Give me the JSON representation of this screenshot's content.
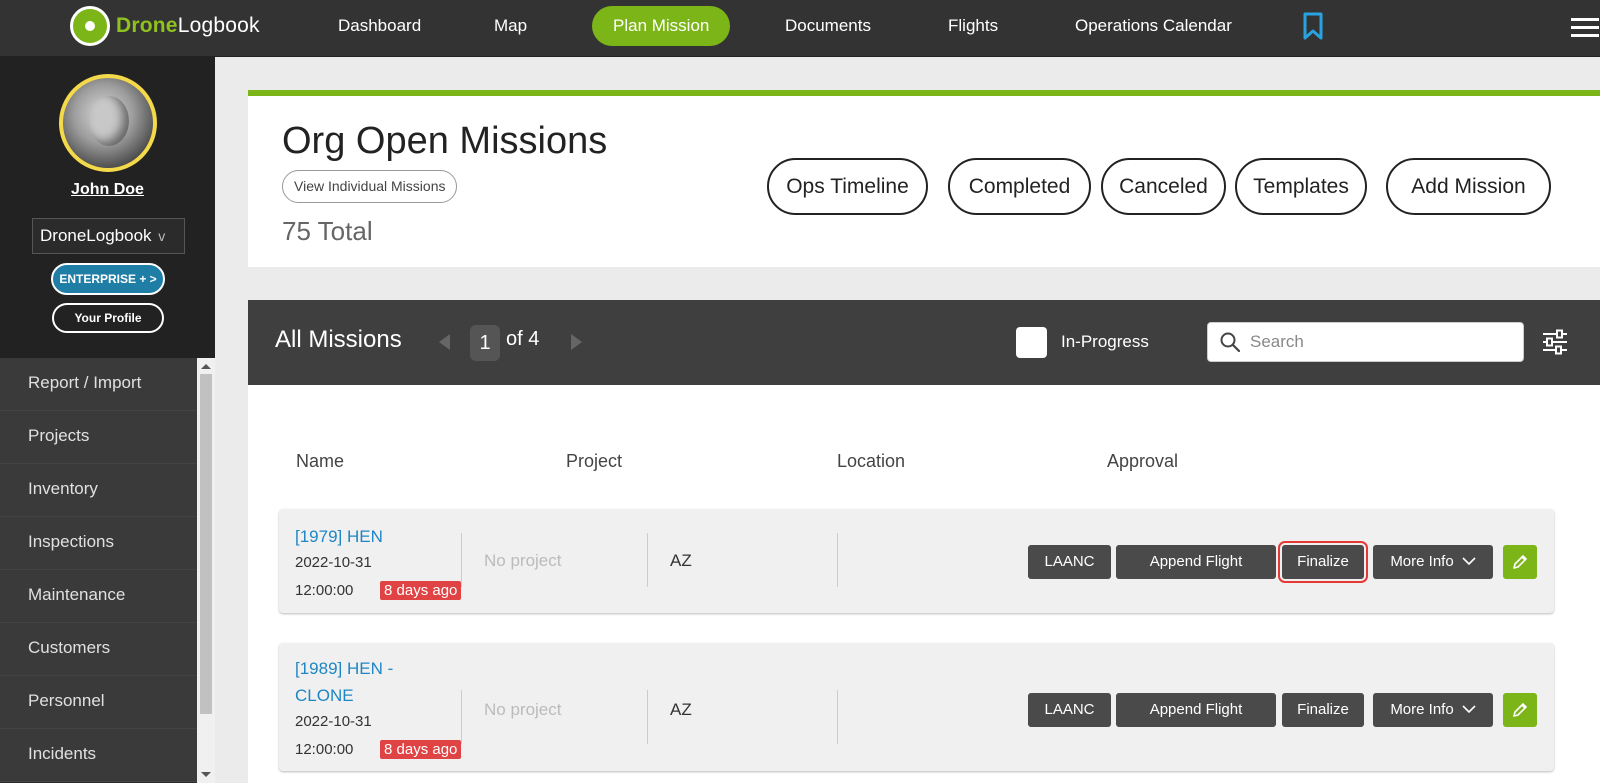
{
  "brand": {
    "part1": "Drone",
    "part2": "Logbook"
  },
  "nav": {
    "items": [
      "Dashboard",
      "Map",
      "Plan Mission",
      "Documents",
      "Flights",
      "Operations Calendar"
    ],
    "active": "Plan Mission"
  },
  "sidebar": {
    "user_name": "John Doe",
    "org": "DroneLogbook",
    "org_chevron": "v",
    "plan_badge": "ENTERPRISE + >",
    "profile_button": "Your Profile",
    "menu": [
      "Report / Import",
      "Projects",
      "Inventory",
      "Inspections",
      "Maintenance",
      "Customers",
      "Personnel",
      "Incidents"
    ]
  },
  "header": {
    "title": "Org Open Missions",
    "view_individual": "View Individual Missions",
    "total": "75 Total",
    "buttons": [
      "Ops Timeline",
      "Completed",
      "Canceled",
      "Templates",
      "Add Mission"
    ]
  },
  "missions_bar": {
    "title": "All Missions",
    "page_current": "1",
    "page_of": "of 4",
    "in_progress_label": "In-Progress",
    "in_progress_checked": false,
    "search_placeholder": "Search"
  },
  "table": {
    "columns": [
      "Name",
      "Project",
      "Location",
      "Approval"
    ],
    "rows": [
      {
        "name": "[1979] HEN",
        "date": "2022-10-31",
        "time": "12:00:00",
        "ago": "8 days ago",
        "project": "No project",
        "location": "AZ",
        "actions": {
          "laanc": "LAANC",
          "append": "Append Flight",
          "finalize": "Finalize",
          "more": "More Info"
        }
      },
      {
        "name_line1": "[1989] HEN -",
        "name_line2": "CLONE",
        "date": "2022-10-31",
        "time": "12:00:00",
        "ago": "8 days ago",
        "project": "No project",
        "location": "AZ",
        "actions": {
          "laanc": "LAANC",
          "append": "Append Flight",
          "finalize": "Finalize",
          "more": "More Info"
        }
      }
    ]
  },
  "colors": {
    "accent": "#7cb518",
    "link": "#1f86c4",
    "alert": "#e04343",
    "dark": "#3f3f3f"
  }
}
